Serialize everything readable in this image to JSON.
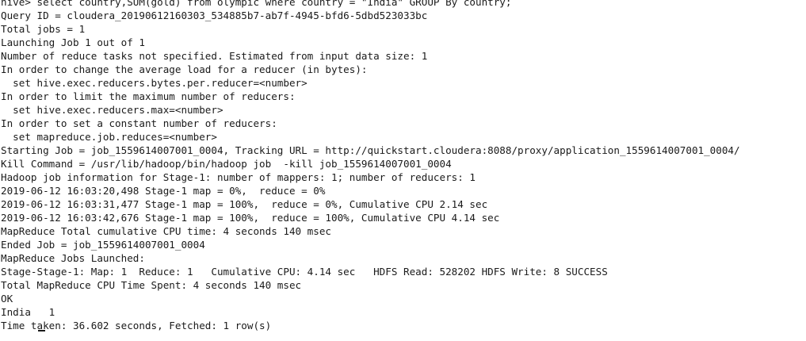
{
  "terminal": {
    "lines": [
      "hive> select country,SUM(gold) from olympic where country = \"India\" GROUP By country;",
      "Query ID = cloudera_20190612160303_534885b7-ab7f-4945-bfd6-5dbd523033bc",
      "Total jobs = 1",
      "Launching Job 1 out of 1",
      "Number of reduce tasks not specified. Estimated from input data size: 1",
      "In order to change the average load for a reducer (in bytes):",
      "  set hive.exec.reducers.bytes.per.reducer=<number>",
      "In order to limit the maximum number of reducers:",
      "  set hive.exec.reducers.max=<number>",
      "In order to set a constant number of reducers:",
      "  set mapreduce.job.reduces=<number>",
      "Starting Job = job_1559614007001_0004, Tracking URL = http://quickstart.cloudera:8088/proxy/application_1559614007001_0004/",
      "Kill Command = /usr/lib/hadoop/bin/hadoop job  -kill job_1559614007001_0004",
      "Hadoop job information for Stage-1: number of mappers: 1; number of reducers: 1",
      "2019-06-12 16:03:20,498 Stage-1 map = 0%,  reduce = 0%",
      "2019-06-12 16:03:31,477 Stage-1 map = 100%,  reduce = 0%, Cumulative CPU 2.14 sec",
      "2019-06-12 16:03:42,676 Stage-1 map = 100%,  reduce = 100%, Cumulative CPU 4.14 sec",
      "MapReduce Total cumulative CPU time: 4 seconds 140 msec",
      "Ended Job = job_1559614007001_0004",
      "MapReduce Jobs Launched:",
      "Stage-Stage-1: Map: 1  Reduce: 1   Cumulative CPU: 4.14 sec   HDFS Read: 528202 HDFS Write: 8 SUCCESS",
      "Total MapReduce CPU Time Spent: 4 seconds 140 msec",
      "OK",
      "India   1",
      "Time taken: 36.602 seconds, Fetched: 1 row(s)"
    ]
  }
}
